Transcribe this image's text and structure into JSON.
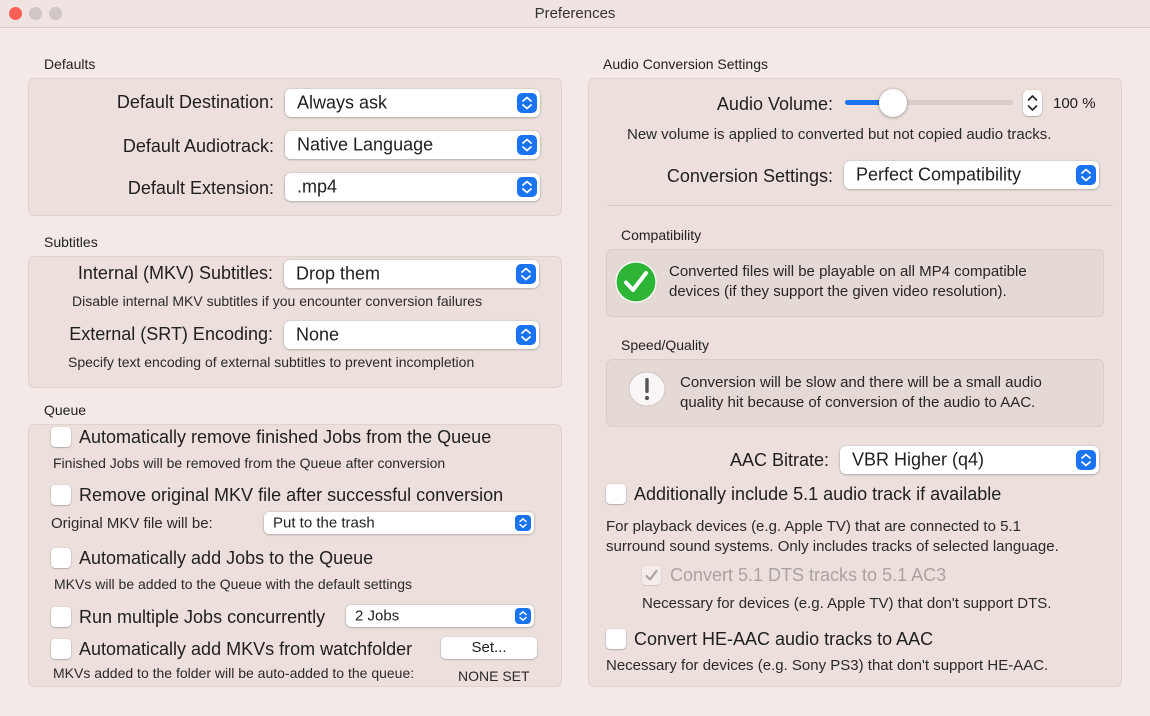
{
  "window": {
    "title": "Preferences",
    "traffic_colors": [
      "#fd5f57",
      "#d0c8c6",
      "#d0c8c6"
    ]
  },
  "defaults": {
    "title": "Defaults",
    "destination_label": "Default Destination:",
    "destination_value": "Always ask",
    "audiotrack_label": "Default Audiotrack:",
    "audiotrack_value": "Native Language",
    "extension_label": "Default Extension:",
    "extension_value": ".mp4"
  },
  "subtitles": {
    "title": "Subtitles",
    "internal_label": "Internal (MKV) Subtitles:",
    "internal_value": "Drop them",
    "internal_help": "Disable internal MKV subtitles if you encounter conversion failures",
    "external_label": "External (SRT) Encoding:",
    "external_value": "None",
    "external_help": "Specify text encoding of external subtitles to prevent incompletion"
  },
  "queue": {
    "title": "Queue",
    "auto_remove_label": "Automatically remove finished Jobs from the Queue",
    "auto_remove_help": "Finished Jobs will be removed from the Queue after conversion",
    "remove_original_label": "Remove original MKV file after successful conversion",
    "original_will_be_label": "Original MKV file will be:",
    "original_will_be_value": "Put to the trash",
    "auto_add_label": "Automatically add Jobs to the Queue",
    "auto_add_help": "MKVs will be added to the Queue with the default settings",
    "concurrent_label": "Run multiple Jobs concurrently",
    "concurrent_value": "2 Jobs",
    "watchfolder_label": "Automatically add MKVs from watchfolder",
    "watchfolder_button": "Set...",
    "watchfolder_help": "MKVs added to the folder will be auto-added to the queue:",
    "watchfolder_value": "NONE SET"
  },
  "audio": {
    "title": "Audio Conversion Settings",
    "volume_label": "Audio Volume:",
    "volume_value": "100 %",
    "volume_level": 0.2,
    "volume_help": "New volume is applied to converted but not copied audio tracks.",
    "conversion_label": "Conversion Settings:",
    "conversion_value": "Perfect Compatibility",
    "compat_title": "Compatibility",
    "compat_text_1": "Converted files will be playable on all MP4 compatible",
    "compat_text_2": "devices (if they support the given video resolution).",
    "speed_title": "Speed/Quality",
    "speed_text_1": "Conversion will be slow and there will be a small audio",
    "speed_text_2": "quality hit because of conversion of the audio to AAC.",
    "bitrate_label": "AAC Bitrate:",
    "bitrate_value": "VBR Higher (q4)",
    "include51_label": "Additionally include 5.1 audio track if available",
    "include51_help_1": "For playback devices (e.g. Apple TV) that are connected to 5.1",
    "include51_help_2": "surround sound systems. Only includes tracks of selected language.",
    "dts_label": "Convert 5.1 DTS tracks to 5.1 AC3",
    "dts_help": "Necessary for devices (e.g. Apple TV) that don't support DTS.",
    "heaac_label": "Convert HE-AAC audio tracks to AAC",
    "heaac_help": "Necessary for devices (e.g. Sony PS3) that don't support HE-AAC."
  },
  "colors": {
    "accent": "#1a73f0",
    "check_green": "#2fb536"
  }
}
